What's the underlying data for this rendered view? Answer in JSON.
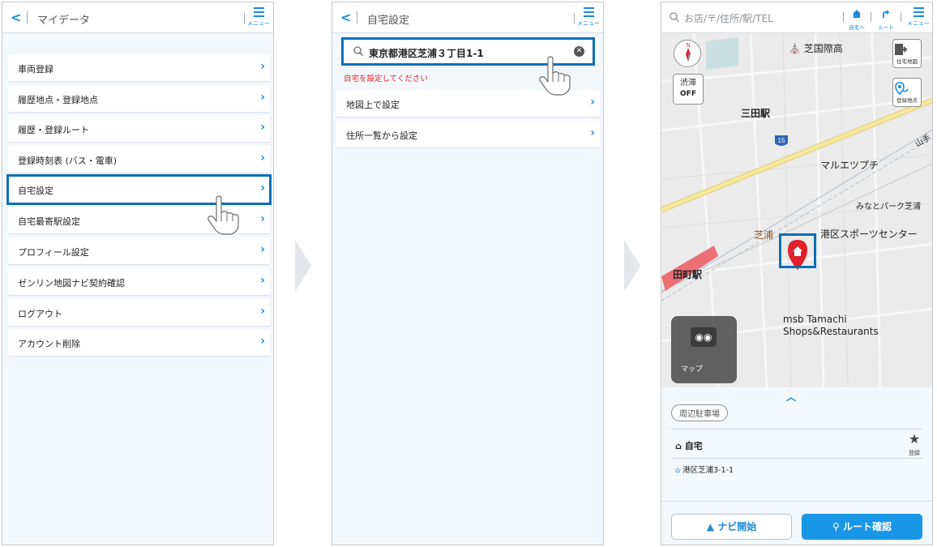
{
  "screen1": {
    "title": "マイデータ",
    "menu_label": "メニュー",
    "items": [
      "車両登録",
      "履歴地点・登録地点",
      "履歴・登録ルート",
      "登録時刻表 (バス・電車)",
      "自宅設定",
      "自宅最寄駅設定",
      "プロフィール設定",
      "ゼンリン地図ナビ契約確認",
      "ログアウト",
      "アカウント削除"
    ],
    "highlighted_item": "自宅設定"
  },
  "screen2": {
    "title": "自宅設定",
    "menu_label": "メニュー",
    "search_value": "東京都港区芝浦３丁目1-1",
    "warning": "自宅を設定してください",
    "items": [
      "地図上で設定",
      "住所一覧から設定"
    ]
  },
  "screen3": {
    "search_placeholder": "お店/〒/住所/駅/TEL",
    "header_icons": {
      "home": "自宅へ",
      "route": "ルート",
      "menu": "メニュー"
    },
    "map_buttons": {
      "traffic": "渋滞",
      "traffic_state": "OFF",
      "home_map": "住宅地図",
      "registered": "登録地点"
    },
    "map_labels": {
      "shibakoku": "芝国際高",
      "mita": "三田駅",
      "route15": "15",
      "maruetsu": "マルエツプチ",
      "minato_park": "みなとパーク芝浦",
      "minato_sports": "港区スポーツセンター",
      "shibaura": "芝浦",
      "tamachi": "田町駅",
      "yamanote": "山手",
      "msb1": "msb Tamachi",
      "msb2": "Shops&Restaurants",
      "apple_maps": "マップ"
    },
    "panel": {
      "parking_pill": "周辺駐車場",
      "home_label": "自宅",
      "register_label": "登録",
      "address": "港区芝浦3-1-1"
    },
    "buttons": {
      "navi": "ナビ開始",
      "route": "ルート確認"
    }
  },
  "colors": {
    "accent": "#1a8ad8",
    "highlight": "#0b6fb8",
    "warning": "#e02020",
    "marker": "#e0202b"
  }
}
